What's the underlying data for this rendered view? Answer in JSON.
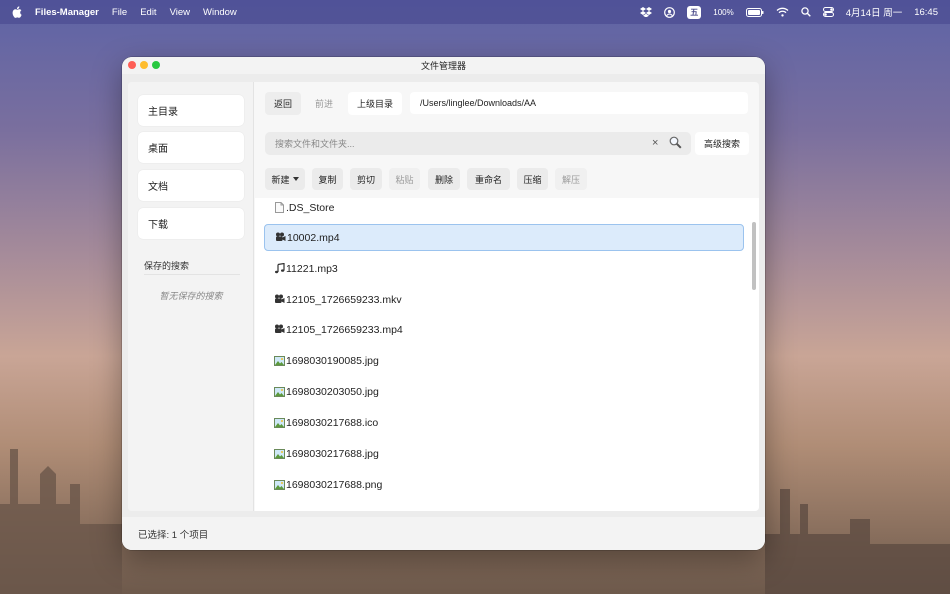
{
  "menubar": {
    "app_name": "Files-Manager",
    "menus": [
      "File",
      "Edit",
      "View",
      "Window"
    ],
    "ime": "五",
    "battery": "100%",
    "date": "4月14日 周一",
    "time": "16:45"
  },
  "window": {
    "title": "文件管理器"
  },
  "sidebar": {
    "items": [
      {
        "label": "主目录"
      },
      {
        "label": "桌面"
      },
      {
        "label": "文档"
      },
      {
        "label": "下载"
      }
    ],
    "saved_title": "保存的搜索",
    "saved_empty": "暂无保存的搜索"
  },
  "nav": {
    "back": "返回",
    "forward": "前进",
    "up": "上级目录",
    "path": "/Users/linglee/Downloads/AA"
  },
  "search": {
    "placeholder": "搜索文件和文件夹...",
    "clear": "×",
    "advanced": "高级搜索"
  },
  "toolbar": {
    "new": "新建",
    "copy": "复制",
    "cut": "剪切",
    "paste": "粘贴",
    "delete": "删除",
    "rename": "重命名",
    "compress": "压缩",
    "extract": "解压"
  },
  "files": [
    {
      "name": ".DS_Store",
      "icon": "document-icon"
    },
    {
      "name": "10002.mp4",
      "icon": "video-camera-icon",
      "selected": true
    },
    {
      "name": "11221.mp3",
      "icon": "music-note-icon"
    },
    {
      "name": "12105_1726659233.mkv",
      "icon": "video-camera-icon"
    },
    {
      "name": "12105_1726659233.mp4",
      "icon": "video-camera-icon"
    },
    {
      "name": "1698030190085.jpg",
      "icon": "picture-icon"
    },
    {
      "name": "1698030203050.jpg",
      "icon": "picture-icon"
    },
    {
      "name": "1698030217688.ico",
      "icon": "picture-icon"
    },
    {
      "name": "1698030217688.jpg",
      "icon": "picture-icon"
    },
    {
      "name": "1698030217688.png",
      "icon": "picture-icon"
    }
  ],
  "status": {
    "text": "已选择: 1 个项目"
  }
}
